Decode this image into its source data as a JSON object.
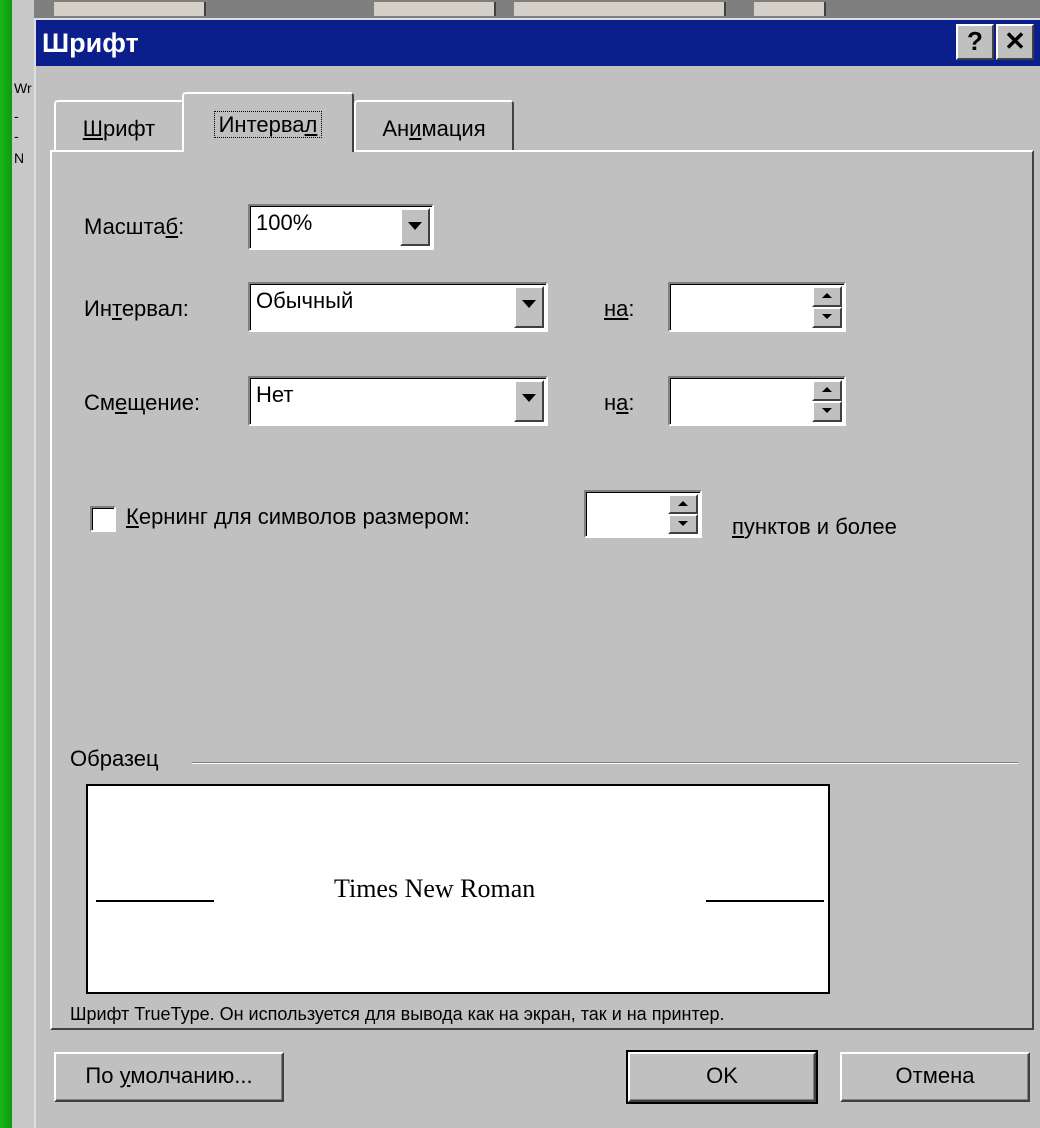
{
  "background": {
    "left_fragments": [
      "Wr",
      "-",
      "-",
      "N"
    ]
  },
  "dialog": {
    "title": "Шрифт",
    "help_button": "?",
    "close_button": "✕"
  },
  "tabs": [
    {
      "label_before": "",
      "accel": "Ш",
      "label_after": "рифт",
      "active": false
    },
    {
      "label_before": "Интерва",
      "accel": "л",
      "label_after": "",
      "active": true
    },
    {
      "label_before": "Ан",
      "accel": "и",
      "label_after": "мация",
      "active": false
    }
  ],
  "scale": {
    "label_before": "Масшта",
    "accel": "б",
    "label_after": ":",
    "value": "100%"
  },
  "spacing": {
    "label_before": "Ин",
    "accel": "т",
    "label_after": "ервал:",
    "value": "Обычный",
    "by_label_before": "",
    "by_accel": "на",
    "by_label_after": ":",
    "by_value": ""
  },
  "position": {
    "label_before": "См",
    "accel": "е",
    "label_after": "щение:",
    "value": "Нет",
    "by_label_before": "н",
    "by_accel": "а",
    "by_label_after": ":",
    "by_value": ""
  },
  "kerning": {
    "checked": false,
    "label_accel": "К",
    "label_rest": "ернинг для символов размером:",
    "value": "",
    "suffix_accel": "п",
    "suffix_rest": "унктов и более"
  },
  "sample": {
    "group_label": "Образец",
    "preview_text": "Times New Roman",
    "description": "Шрифт TrueType. Он используется для вывода как на экран, так и на принтер."
  },
  "buttons": {
    "default_before": "По ",
    "default_accel": "у",
    "default_after": "молчанию...",
    "ok": "OK",
    "cancel": "Отмена"
  }
}
